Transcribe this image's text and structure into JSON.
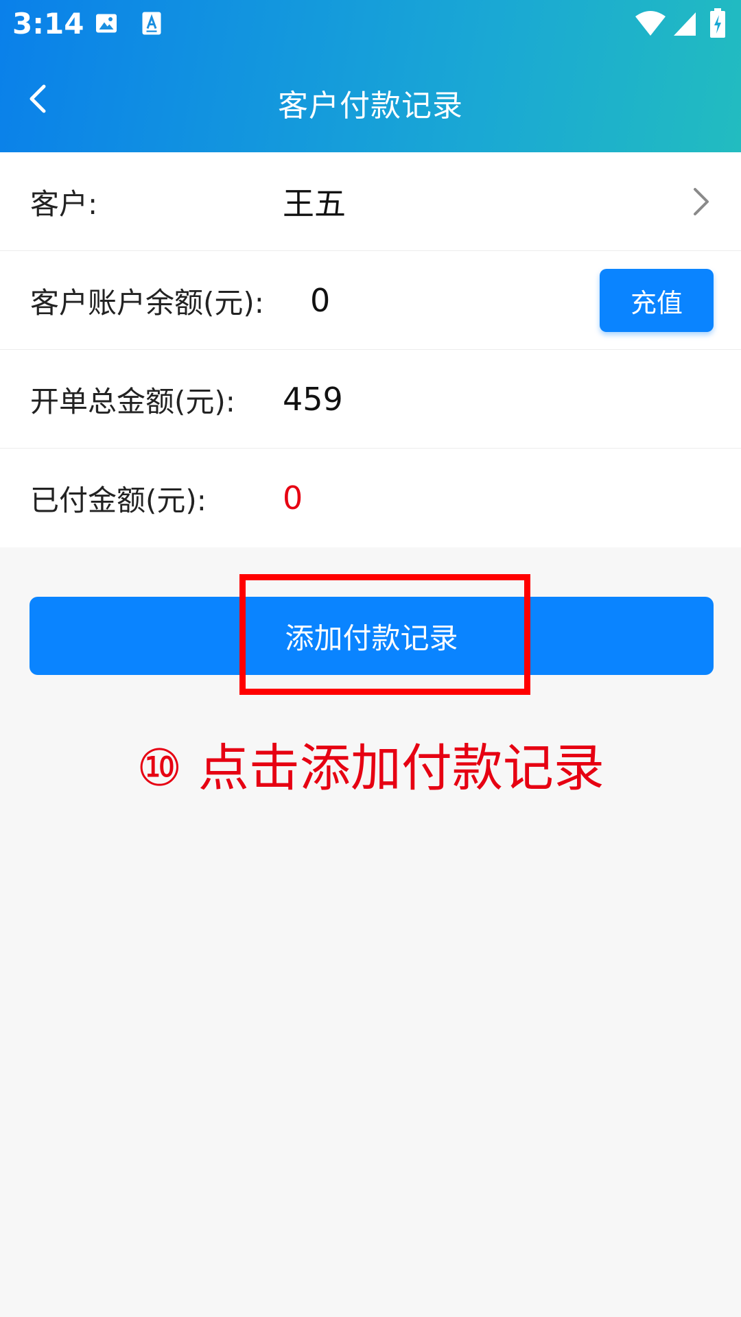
{
  "status_bar": {
    "time": "3:14",
    "icons": [
      "image-icon",
      "text-app-icon",
      "wifi-icon",
      "signal-icon",
      "battery-charging-icon"
    ]
  },
  "nav": {
    "title": "客户付款记录",
    "back_icon": "chevron-left-icon"
  },
  "form": {
    "customer": {
      "label": "客户:",
      "value": "王五"
    },
    "balance": {
      "label": "客户账户余额(元):",
      "value": "0",
      "button_label": "充值"
    },
    "total": {
      "label": "开单总金额(元):",
      "value": "459"
    },
    "paid": {
      "label": "已付金额(元):",
      "value": "0"
    }
  },
  "actions": {
    "add_label": "添加付款记录"
  },
  "annotation": {
    "instruction": "⑩ 点击添加付款记录"
  },
  "colors": {
    "accent": "#0a84ff",
    "highlight": "#ff0000",
    "warning_text": "#e60012"
  }
}
